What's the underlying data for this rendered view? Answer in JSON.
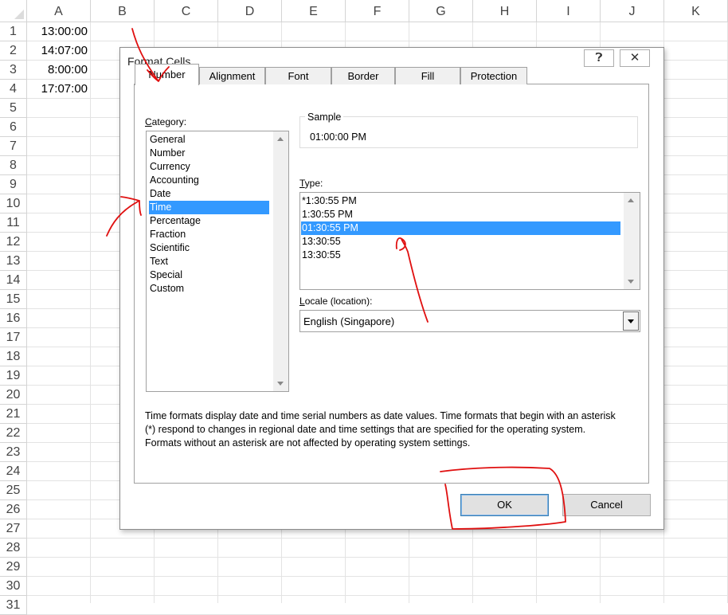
{
  "sheet": {
    "columns": [
      "A",
      "B",
      "C",
      "D",
      "E",
      "F",
      "G",
      "H",
      "I",
      "J",
      "K"
    ],
    "rows": [
      "1",
      "2",
      "3",
      "4",
      "5",
      "6",
      "7",
      "8",
      "9",
      "10",
      "11",
      "12",
      "13",
      "14",
      "15",
      "16",
      "17",
      "18",
      "19",
      "20",
      "21",
      "22",
      "23",
      "24",
      "25",
      "26",
      "27",
      "28",
      "29",
      "30",
      "31"
    ],
    "cells_A": [
      "13:00:00",
      "14:07:00",
      "8:00:00",
      "17:07:00"
    ]
  },
  "dialog": {
    "title": "Format Cells",
    "help_icon": "question-icon",
    "close_icon": "close-icon",
    "tabs": [
      "Number",
      "Alignment",
      "Font",
      "Border",
      "Fill",
      "Protection"
    ],
    "active_tab": "Number",
    "category_label_u": "C",
    "category_label_rest": "ategory:",
    "categories": [
      "General",
      "Number",
      "Currency",
      "Accounting",
      "Date",
      "Time",
      "Percentage",
      "Fraction",
      "Scientific",
      "Text",
      "Special",
      "Custom"
    ],
    "selected_category": "Time",
    "sample_label": "Sample",
    "sample_value": "01:00:00 PM",
    "type_label_u": "T",
    "type_label_rest": "ype:",
    "types": [
      "*1:30:55 PM",
      "1:30:55 PM",
      "01:30:55 PM",
      "13:30:55",
      "13:30:55"
    ],
    "selected_type": "01:30:55 PM",
    "locale_label_u": "L",
    "locale_label_rest": "ocale (location):",
    "locale_value": "English (Singapore)",
    "description": "Time formats display date and time serial numbers as date values.  Time formats that begin with an asterisk (*) respond to changes in regional date and time settings that are specified for the operating system. Formats without an asterisk are not affected by operating system settings.",
    "ok_label": "OK",
    "cancel_label": "Cancel"
  },
  "colors": {
    "selection": "#3399ff",
    "annotation": "#e01010"
  }
}
